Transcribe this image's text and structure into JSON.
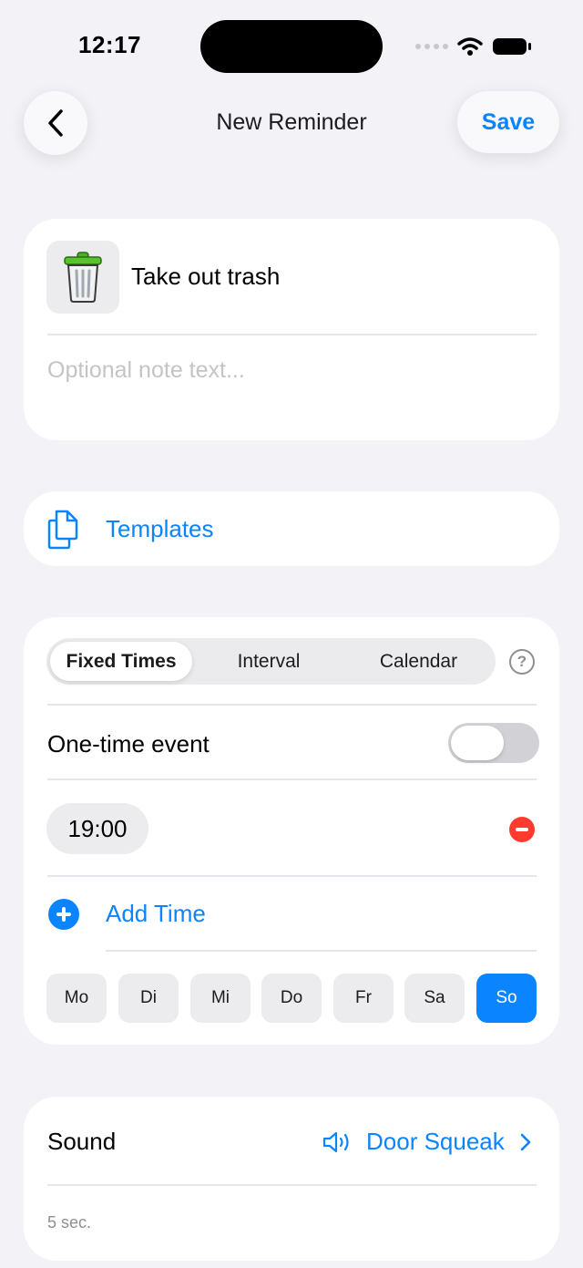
{
  "status_bar": {
    "time": "12:17"
  },
  "nav": {
    "title": "New Reminder",
    "save_label": "Save"
  },
  "reminder": {
    "icon": "trash-can-icon",
    "title": "Take out trash",
    "note_placeholder": "Optional note text..."
  },
  "templates": {
    "icon": "document-stack-icon",
    "label": "Templates"
  },
  "schedule": {
    "tabs": [
      {
        "label": "Fixed Times",
        "selected": true
      },
      {
        "label": "Interval",
        "selected": false
      },
      {
        "label": "Calendar",
        "selected": false
      }
    ],
    "one_time_label": "One-time event",
    "one_time_enabled": false,
    "times": [
      "19:00"
    ],
    "add_time_label": "Add Time",
    "days": [
      {
        "label": "Mo",
        "active": false
      },
      {
        "label": "Di",
        "active": false
      },
      {
        "label": "Mi",
        "active": false
      },
      {
        "label": "Do",
        "active": false
      },
      {
        "label": "Fr",
        "active": false
      },
      {
        "label": "Sa",
        "active": false
      },
      {
        "label": "So",
        "active": true
      }
    ]
  },
  "sound": {
    "label": "Sound",
    "value": "Door Squeak",
    "duration": "5 sec."
  },
  "colors": {
    "accent": "#0a84ff",
    "destructive": "#ff3b30",
    "background": "#f2f2f7"
  }
}
